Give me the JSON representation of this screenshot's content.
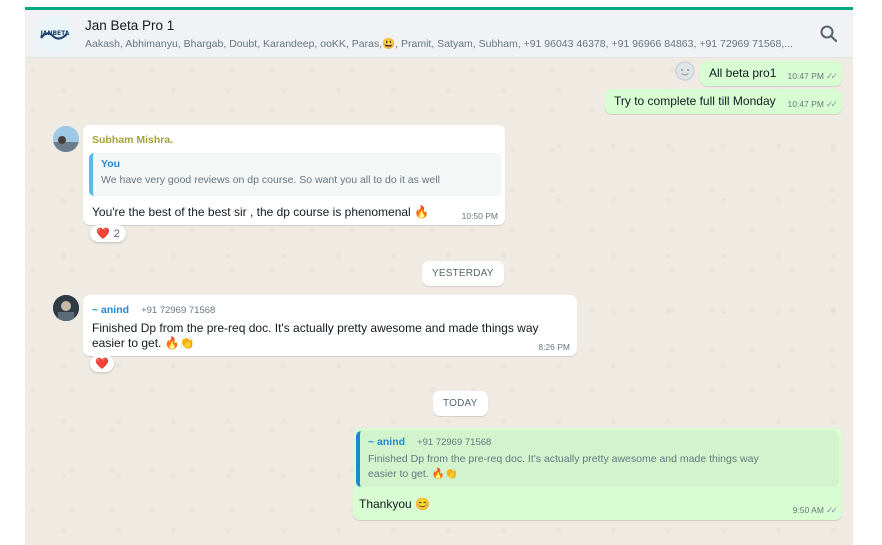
{
  "header": {
    "title": "Jan Beta Pro 1",
    "members": "Aakash, Abhimanyu, Bhargab, Doubt, Karandeep, ooKK, Paras,😃, Pramit, Satyam, Subham, +91 96043 46378, +91 96966 84863, +91 72969 71568,...",
    "avatar_text": "JANBETA",
    "search_icon": "search-icon"
  },
  "messages": {
    "m1": {
      "text": "All beta pro1",
      "time": "10:47 PM"
    },
    "m2": {
      "text": "Try to complete full till Monday",
      "time": "10:47 PM"
    },
    "m3": {
      "sender": "Subham Mishra.",
      "quote_name": "You",
      "quote_text": "We have very good reviews on dp course. So want you all to do it as well",
      "text": "You're the best of the best sir , the dp course is phenomenal 🔥",
      "time": "10:50 PM",
      "reaction_emoji": "❤️",
      "reaction_count": "2"
    },
    "m4": {
      "sender": "~ anind",
      "phone": "+91 72969 71568",
      "text": "Finished Dp from the pre-req doc. It's actually pretty awesome and made things way easier to get. 🔥👏",
      "time": "8:26 PM",
      "reaction_emoji": "❤️"
    },
    "m5": {
      "quote_name": "~ anind",
      "quote_phone": "+91 72969 71568",
      "quote_text": "Finished Dp from the pre-req doc. It's actually pretty awesome and made things way easier to get. 🔥👏",
      "text": "Thankyou 😊",
      "time": "9:50 AM"
    }
  },
  "dividers": {
    "yesterday": "YESTERDAY",
    "today": "TODAY"
  },
  "colors": {
    "accent": "#00a884",
    "outgoing": "#d9fdd3",
    "incoming": "#ffffff",
    "subham_name": "#a0a33a",
    "anind_name": "#1e88d4"
  }
}
